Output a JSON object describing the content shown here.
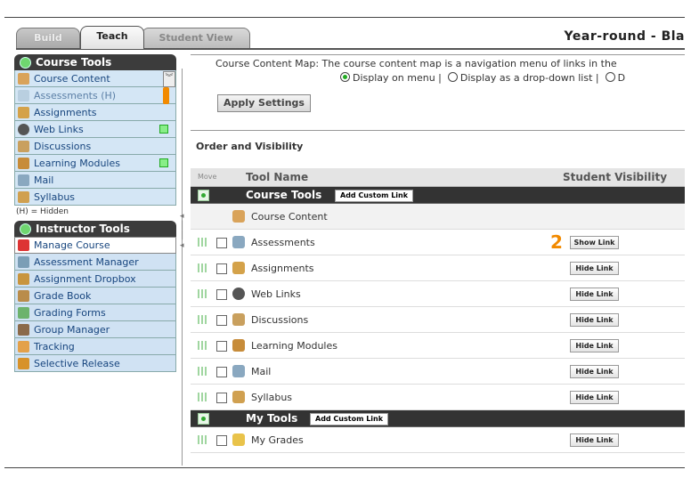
{
  "tabs": {
    "build": "Build",
    "teach": "Teach",
    "student_view": "Student View"
  },
  "page_title": "Year-round - Bla",
  "course_tools": {
    "title": "Course Tools",
    "items": [
      {
        "label": "Course Content",
        "icon": "course-content-icon"
      },
      {
        "label": "Assessments (H)",
        "icon": "assessments-icon"
      },
      {
        "label": "Assignments",
        "icon": "assignments-icon"
      },
      {
        "label": "Web Links",
        "icon": "web-links-icon"
      },
      {
        "label": "Discussions",
        "icon": "discussions-icon"
      },
      {
        "label": "Learning Modules",
        "icon": "learning-modules-icon"
      },
      {
        "label": "Mail",
        "icon": "mail-icon"
      },
      {
        "label": "Syllabus",
        "icon": "syllabus-icon"
      }
    ],
    "hidden_note": "(H) = Hidden",
    "marker_1": "1"
  },
  "instructor_tools": {
    "title": "Instructor Tools",
    "items": [
      {
        "label": "Manage Course",
        "icon": "manage-course-icon"
      },
      {
        "label": "Assessment Manager",
        "icon": "assessment-manager-icon"
      },
      {
        "label": "Assignment Dropbox",
        "icon": "assignment-dropbox-icon"
      },
      {
        "label": "Grade Book",
        "icon": "grade-book-icon"
      },
      {
        "label": "Grading Forms",
        "icon": "grading-forms-icon"
      },
      {
        "label": "Group Manager",
        "icon": "group-manager-icon"
      },
      {
        "label": "Tracking",
        "icon": "tracking-icon"
      },
      {
        "label": "Selective Release",
        "icon": "selective-release-icon"
      }
    ]
  },
  "content_map": {
    "line1": "Course Content Map:  The course content map is a navigation menu of links in the",
    "opt1": "Display on menu  |",
    "opt2": "Display as a drop-down list  |",
    "opt3": "D",
    "apply": "Apply Settings"
  },
  "order_visibility": {
    "title": "Order and Visibility",
    "col_move": "Move",
    "col_tool": "Tool Name",
    "col_vis": "Student Visibility",
    "add_custom_link": "Add Custom Link",
    "section1": "Course Tools",
    "section2": "My Tools",
    "rows": [
      {
        "name": "Course Content",
        "button": ""
      },
      {
        "name": "Assessments",
        "button": "Show Link"
      },
      {
        "name": "Assignments",
        "button": "Hide Link"
      },
      {
        "name": "Web Links",
        "button": "Hide Link"
      },
      {
        "name": "Discussions",
        "button": "Hide Link"
      },
      {
        "name": "Learning Modules",
        "button": "Hide Link"
      },
      {
        "name": "Mail",
        "button": "Hide Link"
      },
      {
        "name": "Syllabus",
        "button": "Hide Link"
      }
    ],
    "my_rows": [
      {
        "name": "My Grades",
        "button": "Hide Link"
      }
    ],
    "marker_2": "2"
  },
  "colors": {
    "accent_orange": "#f28a00",
    "panel_dark": "#3c3c3c",
    "nav_blue_bg": "#d4e6f5",
    "nav_text": "#17457e"
  }
}
